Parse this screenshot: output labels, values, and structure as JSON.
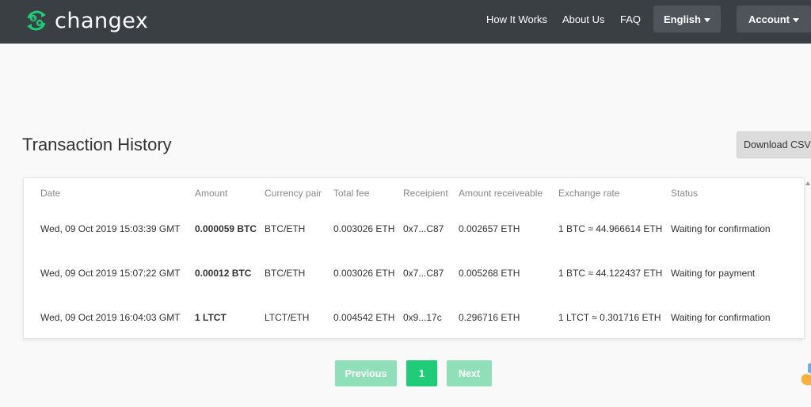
{
  "header": {
    "brand": "changex",
    "nav": [
      "How It Works",
      "About Us",
      "FAQ"
    ],
    "language_label": "English",
    "account_label": "Account"
  },
  "page": {
    "title": "Transaction History",
    "download_label": "Download CSV"
  },
  "table": {
    "columns": [
      "Date",
      "Amount",
      "Currency pair",
      "Total fee",
      "Receipient",
      "Amount receiveable",
      "Exchange rate",
      "Status"
    ],
    "rows": [
      [
        "Wed, 09 Oct 2019 15:03:39 GMT",
        "0.000059 BTC",
        "BTC/ETH",
        "0.003026 ETH",
        "0x7...C87",
        "0.002657 ETH",
        "1 BTC ≈ 44.966614 ETH",
        "Waiting for confirmation"
      ],
      [
        "Wed, 09 Oct 2019 15:07:22 GMT",
        "0.00012 BTC",
        "BTC/ETH",
        "0.003026 ETH",
        "0x7...C87",
        "0.005268 ETH",
        "1 BTC ≈ 44.122437 ETH",
        "Waiting for payment"
      ],
      [
        "Wed, 09 Oct 2019 16:04:03 GMT",
        "1 LTCT",
        "LTCT/ETH",
        "0.004542 ETH",
        "0x9...17c",
        "0.296716 ETH",
        "1 LTCT ≈ 0.301716 ETH",
        "Waiting for confirmation"
      ]
    ]
  },
  "pagination": {
    "previous_label": "Previous",
    "current_page": "1",
    "next_label": "Next"
  },
  "icons": {
    "logo": "currency-exchange-logo-icon",
    "caret": "caret-down-icon"
  },
  "colors": {
    "navbar": "#3a3f44",
    "accent": "#21cc78",
    "accent_disabled": "#8fe0b8"
  }
}
